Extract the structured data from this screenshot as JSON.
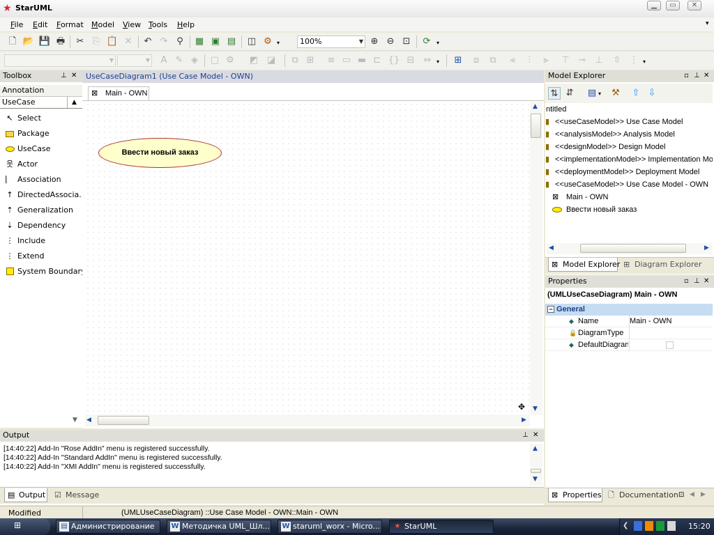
{
  "window": {
    "title": "StarUML",
    "controls": [
      "minimize",
      "maximize",
      "close"
    ]
  },
  "menu": [
    "File",
    "Edit",
    "Format",
    "Model",
    "View",
    "Tools",
    "Help"
  ],
  "toolbar": {
    "zoom": "100%"
  },
  "toolbox": {
    "title": "Toolbox",
    "categories": [
      "Annotation",
      "UseCase"
    ],
    "items": [
      {
        "label": "Select",
        "icon": "pointer-icon"
      },
      {
        "label": "Package",
        "icon": "package-icon"
      },
      {
        "label": "UseCase",
        "icon": "usecase-icon"
      },
      {
        "label": "Actor",
        "icon": "actor-icon"
      },
      {
        "label": "Association",
        "icon": "association-icon"
      },
      {
        "label": "DirectedAssocia...",
        "icon": "directed-association-icon"
      },
      {
        "label": "Generalization",
        "icon": "generalization-icon"
      },
      {
        "label": "Dependency",
        "icon": "dependency-icon"
      },
      {
        "label": "Include",
        "icon": "include-icon"
      },
      {
        "label": "Extend",
        "icon": "extend-icon"
      },
      {
        "label": "System Boundary",
        "icon": "system-boundary-icon"
      }
    ]
  },
  "diagram": {
    "header": "UseCaseDiagram1 (Use Case Model - OWN)",
    "tab": "Main - OWN",
    "usecase_label": "Ввести новый заказ"
  },
  "output": {
    "title": "Output",
    "lines": [
      "[14:40:22]  Add-In \"Rose AddIn\" menu is registered successfully.",
      "[14:40:22]  Add-In \"Standard AddIn\" menu is registered successfully.",
      "[14:40:22]  Add-In \"XMI AddIn\" menu is registered successfully."
    ],
    "tabs": [
      "Output",
      "Message"
    ]
  },
  "model_explorer": {
    "title": "Model Explorer",
    "root": "ntitled",
    "items": [
      "<<useCaseModel>> Use Case Model",
      "<<analysisModel>> Analysis Model",
      "<<designModel>> Design Model",
      "<<implementationModel>> Implementation Mo",
      "<<deploymentModel>> Deployment Model",
      "<<useCaseModel>> Use Case Model - OWN"
    ],
    "children": [
      "Main - OWN",
      "Ввести новый заказ"
    ],
    "tabs": [
      "Model Explorer",
      "Diagram Explorer"
    ]
  },
  "properties": {
    "title": "Properties",
    "subject": "(UMLUseCaseDiagram) Main - OWN",
    "group": "General",
    "rows": [
      {
        "name": "Name",
        "value": "Main - OWN"
      },
      {
        "name": "DiagramType",
        "value": ""
      },
      {
        "name": "DefaultDiagran",
        "value": ""
      }
    ],
    "tabs": [
      "Properties",
      "Documentation"
    ]
  },
  "status": {
    "mode": "Modified",
    "path": "(UMLUseCaseDiagram) ::Use Case Model - OWN::Main - OWN"
  },
  "taskbar": {
    "tasks": [
      "Администрирование",
      "Методичка UML_Шл...",
      "staruml_worx - Micro...",
      "StarUML"
    ],
    "clock": "15:20"
  },
  "colors": {
    "usecase_fill": "#ffffcc",
    "usecase_border": "#aa3333",
    "group_header": "#c5dcf3"
  }
}
